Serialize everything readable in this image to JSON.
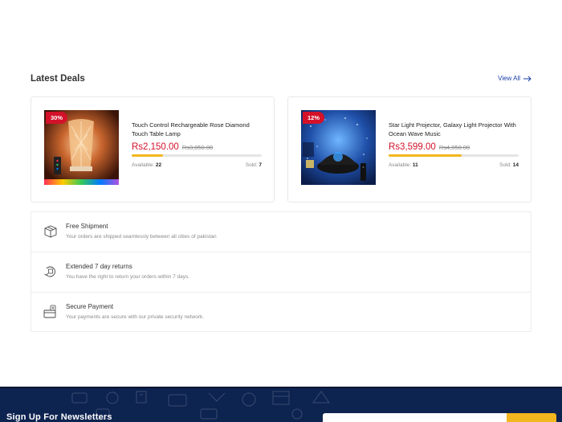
{
  "deals_section": {
    "title": "Latest Deals",
    "view_all_label": "View All"
  },
  "deals": [
    {
      "discount": "30%",
      "title": "Touch Control Rechargeable Rose Diamond Touch Table Lamp",
      "price": "Rs2,150.00",
      "old_price": "Rs3,050.00",
      "available_label": "Available:",
      "available": "22",
      "sold_label": "Sold:",
      "sold": "7",
      "sold_fraction": 0.24
    },
    {
      "discount": "12%",
      "title": "Star Light Projector, Galaxy Light Projector With Ocean Wave Music",
      "price": "Rs3,599.00",
      "old_price": "Rs4,050.00",
      "available_label": "Available:",
      "available": "11",
      "sold_label": "Sold:",
      "sold": "14",
      "sold_fraction": 0.56
    }
  ],
  "features": [
    {
      "icon": "box-icon",
      "title": "Free Shipment",
      "description": "Your orders are shipped seamlessly between all cities of pakistan"
    },
    {
      "icon": "return-icon",
      "title": "Extended 7 day returns",
      "description": "You have the right to return your orders within 7 days."
    },
    {
      "icon": "payment-icon",
      "title": "Secure Payment",
      "description": "Your payments are secure with our private security network."
    }
  ],
  "newsletter": {
    "title": "Sign Up For Newsletters"
  },
  "colors": {
    "accent_red": "#d3122a",
    "link_blue": "#1a3fa8",
    "progress_yellow": "#f2b71f",
    "footer_navy": "#0d2350"
  }
}
